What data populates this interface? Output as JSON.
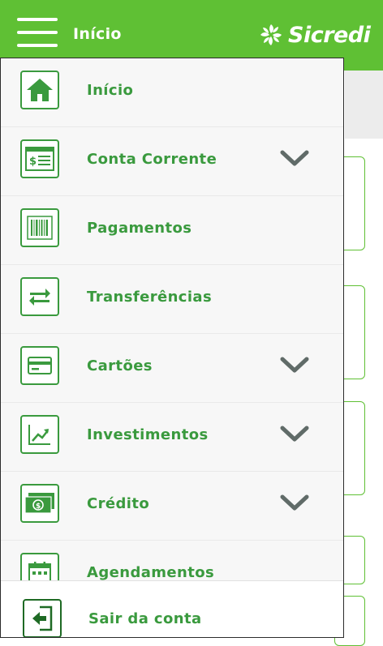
{
  "header": {
    "title": "Início",
    "brand": "Sicredi",
    "menu_icon": "hamburger-icon",
    "background_color": "#5fc034"
  },
  "menu": {
    "items": [
      {
        "label": "Início",
        "icon": "home-icon",
        "expandable": false
      },
      {
        "label": "Conta Corrente",
        "icon": "statement-icon",
        "expandable": true
      },
      {
        "label": "Pagamentos",
        "icon": "barcode-icon",
        "expandable": false
      },
      {
        "label": "Transferências",
        "icon": "transfer-icon",
        "expandable": false
      },
      {
        "label": "Cartões",
        "icon": "credit-card-icon",
        "expandable": true
      },
      {
        "label": "Investimentos",
        "icon": "chart-up-icon",
        "expandable": true
      },
      {
        "label": "Crédito",
        "icon": "money-icon",
        "expandable": true
      },
      {
        "label": "Agendamentos",
        "icon": "calendar-icon",
        "expandable": false
      }
    ],
    "logout": {
      "label": "Sair da conta",
      "icon": "logout-icon"
    }
  },
  "colors": {
    "accent": "#3a9a3e",
    "chevron": "#606b68",
    "drawer_bg": "#f7f7f7"
  }
}
